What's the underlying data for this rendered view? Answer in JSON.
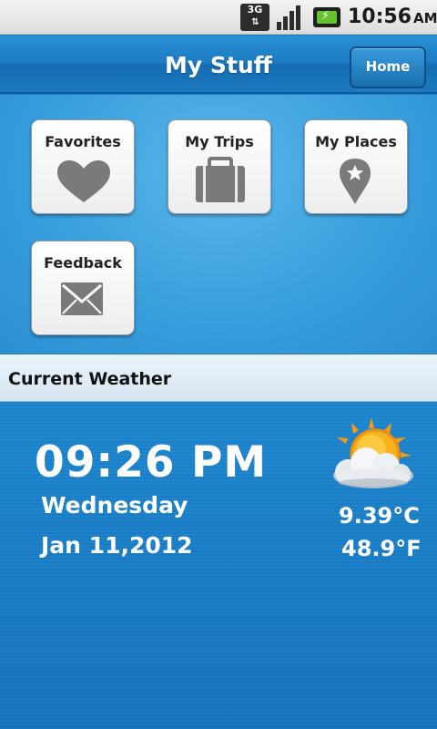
{
  "status_bar": {
    "network": "3G",
    "time": "10:56",
    "ampm": "AM"
  },
  "header": {
    "title": "My Stuff",
    "home_label": "Home"
  },
  "tiles": [
    {
      "label": "Favorites",
      "icon": "heart-icon"
    },
    {
      "label": "My Trips",
      "icon": "suitcase-icon"
    },
    {
      "label": "My Places",
      "icon": "map-pin-star-icon"
    },
    {
      "label": "Feedback",
      "icon": "envelope-icon"
    }
  ],
  "weather": {
    "section_title": "Current Weather",
    "time": "09:26 PM",
    "day": "Wednesday",
    "date": "Jan 11,2012",
    "temp_c": "9.39°C",
    "temp_f": "48.9°F",
    "icon": "partly-cloudy-icon"
  },
  "colors": {
    "primary_blue": "#1a7fc6",
    "tile_icon_gray": "#7a7a7a",
    "sun_orange": "#f7a21b"
  }
}
